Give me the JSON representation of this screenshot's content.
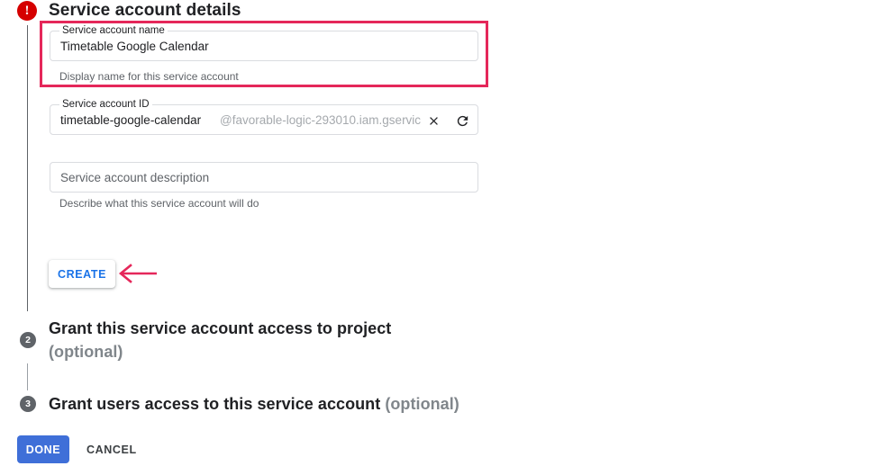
{
  "step1": {
    "status_icon": "error-exclamation-icon",
    "title": "Service account details",
    "name_field": {
      "label": "Service account name",
      "value": "Timetable Google Calendar",
      "helper": "Display name for this service account"
    },
    "id_field": {
      "label": "Service account ID",
      "value": "timetable-google-calendar",
      "suffix": "@favorable-logic-293010.iam.gservic",
      "clear_icon": "close-icon",
      "refresh_icon": "refresh-icon"
    },
    "description_field": {
      "placeholder": "Service account description",
      "helper": "Describe what this service account will do"
    },
    "create_label": "CREATE"
  },
  "step2": {
    "number": "2",
    "title": "Grant this service account access to project",
    "optional": "(optional)"
  },
  "step3": {
    "number": "3",
    "title": "Grant users access to this service account",
    "optional": "(optional)"
  },
  "footer": {
    "done_label": "DONE",
    "cancel_label": "CANCEL"
  },
  "annotations": {
    "highlight_color": "#e5275a",
    "arrow_color": "#e5275a",
    "arrow_direction": "left",
    "error_color": "#d50000",
    "primary_blue": "#1a73e8",
    "done_blue": "#3f6fd8"
  }
}
